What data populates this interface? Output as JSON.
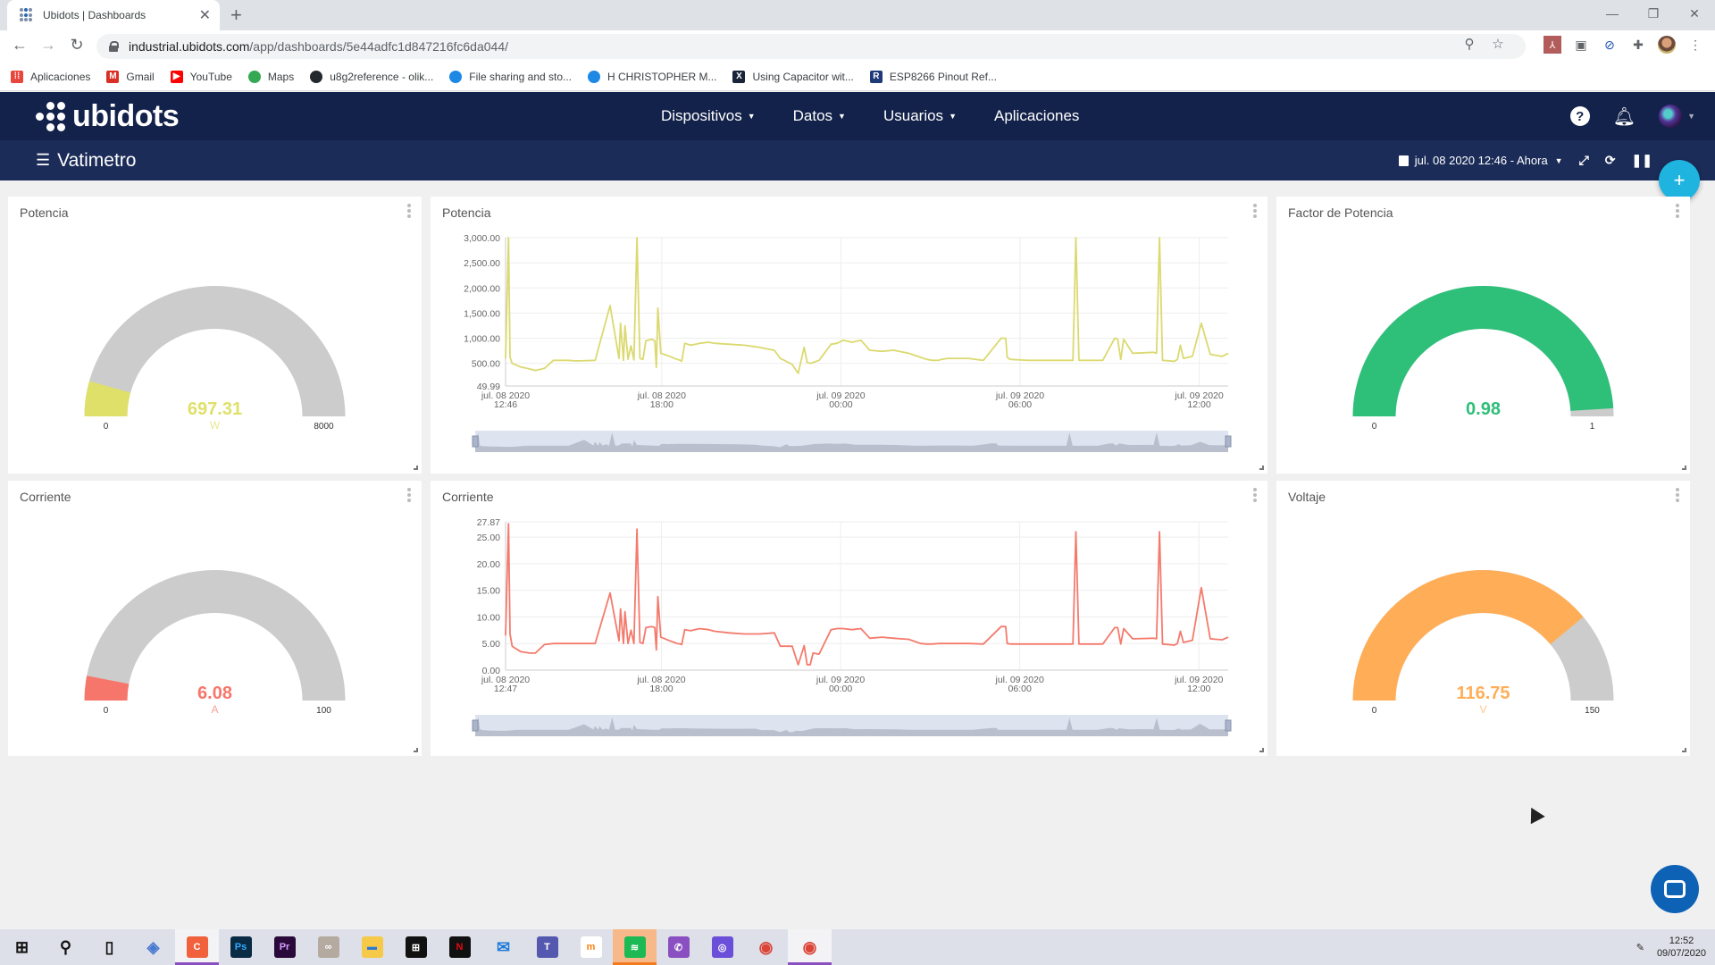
{
  "browser": {
    "tab_title": "Ubidots | Dashboards",
    "url_host": "industrial.ubidots.com",
    "url_path": "/app/dashboards/5e44adfc1d847216fc6da044/",
    "bookmarks": [
      {
        "label": "Aplicaciones",
        "icon": "apps-grid-icon",
        "color": "#e8453c"
      },
      {
        "label": "Gmail",
        "icon": "gmail-icon",
        "color": "#d93025"
      },
      {
        "label": "YouTube",
        "icon": "youtube-icon",
        "color": "#ff0000"
      },
      {
        "label": "Maps",
        "icon": "maps-pin-icon",
        "color": "#34a853"
      },
      {
        "label": "u8g2reference - olik...",
        "icon": "github-icon",
        "color": "#24292e"
      },
      {
        "label": "File sharing and sto...",
        "icon": "sync-icon",
        "color": "#1e88e5"
      },
      {
        "label": "H CHRISTOPHER M...",
        "icon": "sync-icon",
        "color": "#1e88e5"
      },
      {
        "label": "Using Capacitor wit...",
        "icon": "x-logo-icon",
        "color": "#1a2438"
      },
      {
        "label": "ESP8266 Pinout Ref...",
        "icon": "r-logo-icon",
        "color": "#1f3a78"
      }
    ]
  },
  "app": {
    "brand": "ubidots",
    "nav": [
      {
        "label": "Dispositivos",
        "dropdown": true
      },
      {
        "label": "Datos",
        "dropdown": true
      },
      {
        "label": "Usuarios",
        "dropdown": true
      },
      {
        "label": "Aplicaciones",
        "dropdown": false
      }
    ],
    "dashboard_title": "Vatimetro",
    "date_range": "jul. 08 2020 12:46 - Ahora",
    "colors": {
      "header": "#13224a",
      "subheader": "#1b2c58",
      "fab": "#1fb4e0"
    }
  },
  "widgets": {
    "gauge_potencia": {
      "title": "Potencia",
      "value": "697.31",
      "unit": "W",
      "min": 0,
      "max": 8000,
      "min_label": "0",
      "max_label": "8000",
      "color": "#dfe06a"
    },
    "gauge_corriente": {
      "title": "Corriente",
      "value": "6.08",
      "unit": "A",
      "min": 0,
      "max": 100,
      "min_label": "0",
      "max_label": "100",
      "color": "#f7766b"
    },
    "gauge_fp": {
      "title": "Factor de Potencia",
      "value": "0.98",
      "unit": "",
      "min": 0,
      "max": 1,
      "min_label": "0",
      "max_label": "1",
      "color": "#2ebf79"
    },
    "gauge_voltaje": {
      "title": "Voltaje",
      "value": "116.75",
      "unit": "V",
      "min": 0,
      "max": 150,
      "min_label": "0",
      "max_label": "150",
      "color": "#ffae57"
    },
    "chart_potencia": {
      "title": "Potencia"
    },
    "chart_corriente": {
      "title": "Corriente"
    }
  },
  "chart_data": [
    {
      "type": "line",
      "title": "Potencia",
      "color": "#dbd96f",
      "ylim": [
        49.99,
        3000
      ],
      "yticks": [
        "3,000.00",
        "2,500.00",
        "2,000.00",
        "1,500.00",
        "1,000.00",
        "500.00",
        "49.99"
      ],
      "ytick_values": [
        3000,
        2500,
        2000,
        1500,
        1000,
        500,
        49.99
      ],
      "xlim_hours": [
        0,
        24.2
      ],
      "xticks": [
        {
          "h": 0,
          "l1": "jul. 08 2020",
          "l2": "12:46"
        },
        {
          "h": 5.23,
          "l1": "jul. 08 2020",
          "l2": "18:00"
        },
        {
          "h": 11.23,
          "l1": "jul. 09 2020",
          "l2": "00:00"
        },
        {
          "h": 17.23,
          "l1": "jul. 09 2020",
          "l2": "06:00"
        },
        {
          "h": 23.23,
          "l1": "jul. 09 2020",
          "l2": "12:00"
        }
      ],
      "x_hours": [
        0,
        0.1,
        0.15,
        0.22,
        0.3,
        0.5,
        0.8,
        1.0,
        1.3,
        1.6,
        1.9,
        2.1,
        2.3,
        2.5,
        3.0,
        3.5,
        3.8,
        3.85,
        3.95,
        4.0,
        4.1,
        4.2,
        4.3,
        4.4,
        4.5,
        4.6,
        4.7,
        4.9,
        5.0,
        5.05,
        5.1,
        5.2,
        5.5,
        5.65,
        5.75,
        5.85,
        5.9,
        6.0,
        6.2,
        6.5,
        6.8,
        7.0,
        7.5,
        8.0,
        8.5,
        9.0,
        9.2,
        9.6,
        9.8,
        10.0,
        10.1,
        10.2,
        10.3,
        10.5,
        10.9,
        11.1,
        11.3,
        11.6,
        11.9,
        12.2,
        12.6,
        13.0,
        13.5,
        13.9,
        14.1,
        14.3,
        14.5,
        14.6,
        14.8,
        15.5,
        16.0,
        16.6,
        16.75,
        16.8,
        16.9,
        17.5,
        18.5,
        19.0,
        19.1,
        19.2,
        19.3,
        19.6,
        20.0,
        20.4,
        20.5,
        20.6,
        20.7,
        21.0,
        21.7,
        21.8,
        21.9,
        22.0,
        22.4,
        22.5,
        22.6,
        22.7,
        23.0,
        23.3,
        23.6,
        23.8,
        24.0,
        24.2
      ],
      "y": [
        600,
        3000,
        620,
        500,
        480,
        430,
        390,
        360,
        400,
        560,
        560,
        560,
        550,
        550,
        560,
        1650,
        600,
        1300,
        560,
        1250,
        580,
        850,
        570,
        3000,
        600,
        580,
        950,
        980,
        950,
        420,
        1600,
        700,
        640,
        600,
        580,
        560,
        540,
        900,
        860,
        900,
        920,
        900,
        880,
        860,
        820,
        760,
        600,
        480,
        300,
        820,
        520,
        500,
        520,
        560,
        880,
        900,
        960,
        920,
        960,
        760,
        740,
        760,
        700,
        620,
        580,
        560,
        560,
        580,
        600,
        600,
        560,
        1000,
        1000,
        620,
        580,
        560,
        560,
        560,
        3000,
        560,
        560,
        560,
        560,
        1000,
        980,
        580,
        980,
        700,
        720,
        700,
        3000,
        560,
        540,
        580,
        860,
        600,
        640,
        1300,
        680,
        660,
        640,
        700,
        680,
        720
      ]
    },
    {
      "type": "line",
      "title": "Corriente",
      "color": "#f47a6c",
      "ylim": [
        0,
        27.87
      ],
      "yticks": [
        "27.87",
        "25.00",
        "20.00",
        "15.00",
        "10.00",
        "5.00",
        "0.00"
      ],
      "ytick_values": [
        27.87,
        25,
        20,
        15,
        10,
        5,
        0
      ],
      "xlim_hours": [
        0,
        24.2
      ],
      "xticks": [
        {
          "h": 0,
          "l1": "jul. 08 2020",
          "l2": "12:47"
        },
        {
          "h": 5.22,
          "l1": "jul. 08 2020",
          "l2": "18:00"
        },
        {
          "h": 11.22,
          "l1": "jul. 09 2020",
          "l2": "00:00"
        },
        {
          "h": 17.22,
          "l1": "jul. 09 2020",
          "l2": "06:00"
        },
        {
          "h": 23.22,
          "l1": "jul. 09 2020",
          "l2": "12:00"
        }
      ],
      "x_hours": [
        0,
        0.1,
        0.15,
        0.22,
        0.3,
        0.5,
        0.8,
        1.0,
        1.3,
        1.6,
        1.9,
        2.1,
        2.3,
        2.5,
        3.0,
        3.5,
        3.8,
        3.85,
        3.95,
        4.0,
        4.1,
        4.2,
        4.3,
        4.4,
        4.5,
        4.6,
        4.7,
        4.9,
        5.0,
        5.05,
        5.1,
        5.2,
        5.5,
        5.65,
        5.75,
        5.85,
        5.9,
        6.0,
        6.2,
        6.5,
        6.8,
        7.0,
        7.5,
        8.0,
        8.5,
        9.0,
        9.2,
        9.6,
        9.8,
        10.0,
        10.1,
        10.2,
        10.3,
        10.5,
        10.9,
        11.1,
        11.3,
        11.6,
        11.9,
        12.2,
        12.6,
        13.0,
        13.5,
        13.9,
        14.1,
        14.3,
        14.5,
        14.6,
        14.8,
        15.5,
        16.0,
        16.6,
        16.75,
        16.8,
        16.9,
        17.5,
        18.5,
        19.0,
        19.1,
        19.2,
        19.3,
        19.6,
        20.0,
        20.4,
        20.5,
        20.6,
        20.7,
        21.0,
        21.7,
        21.8,
        21.9,
        22.0,
        22.4,
        22.5,
        22.6,
        22.7,
        23.0,
        23.3,
        23.6,
        23.8,
        24.0,
        24.2
      ],
      "y": [
        6.5,
        27.5,
        6.8,
        4.5,
        4.2,
        3.5,
        3.2,
        3.2,
        4.8,
        5.0,
        5.0,
        5.0,
        5.0,
        5.0,
        5.0,
        14.5,
        5.5,
        11.5,
        5.0,
        11.0,
        5.0,
        7.5,
        5.0,
        26.5,
        5.2,
        5.0,
        8.0,
        8.2,
        8.0,
        3.8,
        13.8,
        6.2,
        5.5,
        5.2,
        5.0,
        4.9,
        4.8,
        7.6,
        7.4,
        7.8,
        7.6,
        7.3,
        7.0,
        6.8,
        6.8,
        7.0,
        4.5,
        4.5,
        1.0,
        4.6,
        1.0,
        1.0,
        3.2,
        3.0,
        7.6,
        7.8,
        7.8,
        7.6,
        7.8,
        6.0,
        6.2,
        6.0,
        5.8,
        5.0,
        4.9,
        4.9,
        5.0,
        5.0,
        5.0,
        5.0,
        4.9,
        8.2,
        8.2,
        5.0,
        4.9,
        4.9,
        4.9,
        4.9,
        26.0,
        4.9,
        4.9,
        4.9,
        4.9,
        8.0,
        8.0,
        4.9,
        7.8,
        5.9,
        6.0,
        5.9,
        26.0,
        4.9,
        4.7,
        5.0,
        7.3,
        5.2,
        5.6,
        15.5,
        5.9,
        5.8,
        5.7,
        6.2
      ]
    },
    {
      "type": "pie",
      "title": "Potencia (gauge)",
      "value": 697.31,
      "min": 0,
      "max": 8000,
      "unit": "W"
    },
    {
      "type": "pie",
      "title": "Corriente (gauge)",
      "value": 6.08,
      "min": 0,
      "max": 100,
      "unit": "A"
    },
    {
      "type": "pie",
      "title": "Factor de Potencia (gauge)",
      "value": 0.98,
      "min": 0,
      "max": 1,
      "unit": ""
    },
    {
      "type": "pie",
      "title": "Voltaje (gauge)",
      "value": 116.75,
      "min": 0,
      "max": 150,
      "unit": "V"
    }
  ],
  "taskbar": {
    "apps": [
      {
        "name": "start-icon",
        "glyph": "⊞",
        "bg": "",
        "fg": "#111"
      },
      {
        "name": "search-icon",
        "glyph": "⚲",
        "bg": "",
        "fg": "#111"
      },
      {
        "name": "task-view-icon",
        "glyph": "▯",
        "bg": "",
        "fg": "#111"
      },
      {
        "name": "app-3d-icon",
        "glyph": "◈",
        "bg": "",
        "fg": "#4a7bd0"
      },
      {
        "name": "camtasia-icon",
        "glyph": "C",
        "bg": "#f0613c",
        "fg": "#fff",
        "state": "active"
      },
      {
        "name": "photoshop-icon",
        "glyph": "Ps",
        "bg": "#0a2b44",
        "fg": "#31a8ff"
      },
      {
        "name": "premiere-icon",
        "glyph": "Pr",
        "bg": "#2a0a3a",
        "fg": "#d49dfb"
      },
      {
        "name": "arduino-icon",
        "glyph": "∞",
        "bg": "#b5aaa0",
        "fg": "#fff"
      },
      {
        "name": "file-explorer-icon",
        "glyph": "▬",
        "bg": "#f7c948",
        "fg": "#2b7ad6"
      },
      {
        "name": "store-icon",
        "glyph": "⊞",
        "bg": "#111",
        "fg": "#fff"
      },
      {
        "name": "netflix-icon",
        "glyph": "N",
        "bg": "#111",
        "fg": "#e50914"
      },
      {
        "name": "mail-icon",
        "glyph": "✉",
        "bg": "",
        "fg": "#1e7ad8"
      },
      {
        "name": "teams-icon",
        "glyph": "T",
        "bg": "#5558af",
        "fg": "#fff"
      },
      {
        "name": "moodle-icon",
        "glyph": "m",
        "bg": "#fff",
        "fg": "#f98012"
      },
      {
        "name": "spotify-icon",
        "glyph": "≋",
        "bg": "#1db954",
        "fg": "#fff",
        "state": "orange"
      },
      {
        "name": "whatsapp-icon",
        "glyph": "✆",
        "bg": "#8a4fc0",
        "fg": "#fff"
      },
      {
        "name": "screen-app-icon",
        "glyph": "◎",
        "bg": "#6b4fd8",
        "fg": "#fff"
      },
      {
        "name": "chrome-icon",
        "glyph": "◉",
        "bg": "",
        "fg": "#db4437"
      },
      {
        "name": "chrome-icon",
        "glyph": "◉",
        "bg": "",
        "fg": "#db4437",
        "state": "active"
      }
    ],
    "time": "12:52",
    "date": "09/07/2020"
  }
}
